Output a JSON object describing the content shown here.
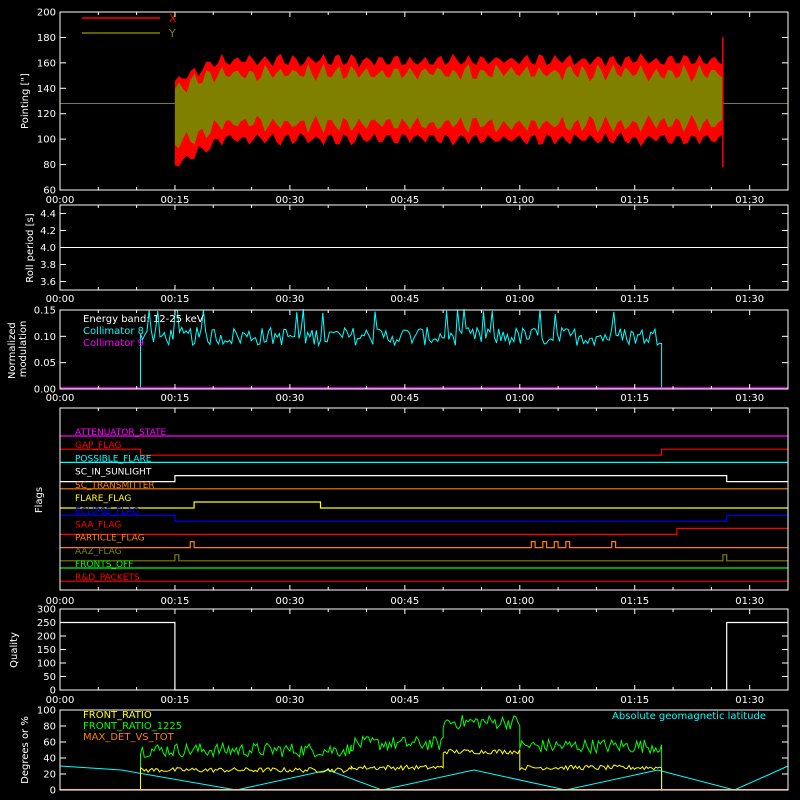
{
  "time_ticks": [
    "00:00",
    "00:15",
    "00:30",
    "00:45",
    "01:00",
    "01:15",
    "01:30"
  ],
  "colors": {
    "bg": "#000000",
    "axis": "#ffffff",
    "x": "#ff0000",
    "y": "#808000",
    "cyan": "#00ffff",
    "magenta": "#ff00ff",
    "yellow": "#ffff00",
    "green": "#00ff00",
    "orange": "#ff8000",
    "blue": "#0000ff"
  },
  "chart_data": [
    {
      "id": "pointing",
      "type": "area",
      "ylabel": "Pointing [\"]",
      "ylim": [
        60,
        200
      ],
      "yticks": [
        "60",
        "80",
        "100",
        "120",
        "140",
        "160",
        "180",
        "200"
      ],
      "xlim_minutes": [
        0,
        95
      ],
      "legend": [
        {
          "name": "X",
          "color": "#ff0000"
        },
        {
          "name": "Y",
          "color": "#808000"
        }
      ],
      "baseline": 128,
      "data_start_minutes": 15,
      "data_end_minutes": 86.5,
      "x_band": {
        "low_start": 80,
        "low_end": 100,
        "high_start": 145,
        "high_end": 162
      },
      "y_band": {
        "low_start": 95,
        "low_end": 112,
        "high_start": 140,
        "high_end": 152
      },
      "end_spike": {
        "min": 78,
        "max": 180
      }
    },
    {
      "id": "roll",
      "type": "line",
      "ylabel": "Roll period [s]",
      "ylim": [
        3.5,
        4.5
      ],
      "yticks": [
        "3.6",
        "3.8",
        "4.0",
        "4.2",
        "4.4"
      ],
      "value": 4.0
    },
    {
      "id": "modulation",
      "type": "line",
      "ylabel": "Normalized modulation",
      "ylim": [
        0,
        0.15
      ],
      "yticks": [
        "0.00",
        "0.05",
        "0.10",
        "0.15"
      ],
      "annotation": "Energy band: 12-25 keV",
      "series": [
        {
          "name": "Collimator 8",
          "color": "#00ffff",
          "start_minutes": 10.5,
          "end_minutes": 78.5,
          "mean": 0.1
        },
        {
          "name": "Collimator 9",
          "color": "#ff00ff",
          "value": 0.0
        }
      ]
    },
    {
      "id": "flags",
      "type": "line",
      "ylabel": "Flags",
      "series": [
        {
          "name": "ATTENUATOR_STATE",
          "color": "#ff00ff",
          "segments": [
            [
              0,
              95,
              0
            ]
          ]
        },
        {
          "name": "GAP_FLAG",
          "color": "#ff0000",
          "segments": [
            [
              0,
              10.5,
              0
            ],
            [
              10.5,
              78.5,
              -1
            ],
            [
              78.5,
              95,
              0
            ]
          ]
        },
        {
          "name": "POSSIBLE_FLARE",
          "color": "#00ffff",
          "segments": [
            [
              0,
              95,
              0
            ]
          ]
        },
        {
          "name": "SC_IN_SUNLIGHT",
          "color": "#ffffff",
          "segments": [
            [
              0,
              15,
              -1
            ],
            [
              15,
              87,
              0
            ],
            [
              87,
              95,
              -1
            ]
          ]
        },
        {
          "name": "SC_TRANSMITTER",
          "color": "#ff8000",
          "segments": [
            [
              0,
              95,
              0
            ]
          ]
        },
        {
          "name": "FLARE_FLAG",
          "color": "#ffff00",
          "segments": [
            [
              0,
              17.5,
              -1
            ],
            [
              17.5,
              34,
              0
            ],
            [
              34,
              95,
              -1
            ]
          ]
        },
        {
          "name": "ECLIPSE_FLAG",
          "color": "#0000ff",
          "segments": [
            [
              0,
              15,
              0
            ],
            [
              15,
              87,
              -1
            ],
            [
              87,
              95,
              0
            ]
          ]
        },
        {
          "name": "SAA_FLAG",
          "color": "#ff0000",
          "segments": [
            [
              0,
              80.5,
              -1
            ],
            [
              80.5,
              95,
              0
            ]
          ]
        },
        {
          "name": "PARTICLE_FLAG",
          "color": "#ff8000",
          "segments": [
            [
              0,
              17,
              -1
            ],
            [
              17,
              17.5,
              0
            ],
            [
              17.5,
              61.5,
              -1
            ],
            [
              61.5,
              62,
              0
            ],
            [
              62,
              63,
              -1
            ],
            [
              63,
              63.5,
              0
            ],
            [
              63.5,
              64.5,
              -1
            ],
            [
              64.5,
              65,
              0
            ],
            [
              65,
              66,
              -1
            ],
            [
              66,
              66.5,
              0
            ],
            [
              66.5,
              72,
              -1
            ],
            [
              72,
              72.5,
              0
            ],
            [
              72.5,
              95,
              -1
            ]
          ]
        },
        {
          "name": "AAZ_FLAG",
          "color": "#808000",
          "segments": [
            [
              0,
              15,
              -1
            ],
            [
              15,
              15.5,
              0
            ],
            [
              15.5,
              86.5,
              -1
            ],
            [
              86.5,
              87,
              0
            ],
            [
              87,
              95,
              -1
            ]
          ]
        },
        {
          "name": "FRONTS_OFF",
          "color": "#00ff00",
          "segments": [
            [
              0,
              95,
              0
            ]
          ]
        },
        {
          "name": "R&D_PACKETS",
          "color": "#ff0000",
          "segments": [
            [
              0,
              95,
              0
            ]
          ]
        }
      ]
    },
    {
      "id": "quality",
      "type": "line",
      "ylabel": "Quality",
      "ylim": [
        0,
        300
      ],
      "yticks": [
        "0",
        "50",
        "100",
        "150",
        "200",
        "250",
        "300"
      ],
      "segments": [
        [
          0,
          15,
          250
        ],
        [
          15,
          87,
          0
        ],
        [
          87,
          95,
          250
        ]
      ]
    },
    {
      "id": "ratios",
      "type": "line",
      "ylabel": "Degrees or %",
      "ylim": [
        0,
        100
      ],
      "yticks": [
        "0",
        "20",
        "40",
        "60",
        "80",
        "100"
      ],
      "right_label": "Absolute geomagnetic latitude",
      "series": [
        {
          "name": "FRONT_RATIO",
          "color": "#ffff00"
        },
        {
          "name": "FRONT_RATIO_1225",
          "color": "#00ff00"
        },
        {
          "name": "MAX_DET_VS_TOT",
          "color": "#ff8000"
        },
        {
          "name": "Absolute geomagnetic latitude",
          "color": "#00ffff"
        }
      ],
      "front_ratio_1225_levels": [
        [
          10.5,
          38,
          50
        ],
        [
          38,
          50,
          58
        ],
        [
          50,
          60,
          85
        ],
        [
          60,
          78.5,
          55
        ]
      ],
      "front_ratio_levels": [
        [
          10.5,
          38,
          25
        ],
        [
          38,
          50,
          28
        ],
        [
          50,
          60,
          48
        ],
        [
          60,
          78.5,
          28
        ]
      ],
      "latitude_points": [
        [
          0,
          30
        ],
        [
          8,
          25
        ],
        [
          23,
          0
        ],
        [
          35,
          25
        ],
        [
          42,
          0
        ],
        [
          54,
          25
        ],
        [
          66,
          0
        ],
        [
          78,
          25
        ],
        [
          88,
          0
        ],
        [
          95,
          30
        ]
      ]
    }
  ]
}
